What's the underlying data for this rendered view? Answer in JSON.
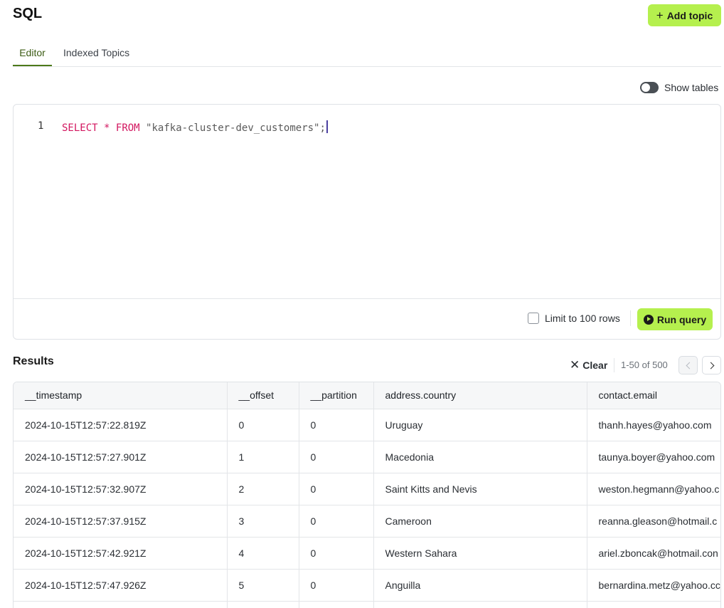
{
  "page": {
    "title": "SQL",
    "add_topic_label": "Add topic"
  },
  "tabs": [
    {
      "label": "Editor",
      "active": true
    },
    {
      "label": "Indexed Topics",
      "active": false
    }
  ],
  "show_tables": {
    "label": "Show tables",
    "enabled": false
  },
  "editor": {
    "line_number": "1",
    "tokens": {
      "select": "SELECT",
      "star": "*",
      "from": "FROM",
      "table": "\"kafka-cluster-dev_customers\"",
      "semicolon": ";"
    }
  },
  "controls": {
    "limit_label": "Limit to 100 rows",
    "limit_checked": false,
    "run_label": "Run query"
  },
  "results": {
    "title": "Results",
    "clear_label": "Clear",
    "range_label": "1-50 of 500",
    "columns": [
      "__timestamp",
      "__offset",
      "__partition",
      "address.country",
      "contact.email"
    ],
    "rows": [
      [
        "2024-10-15T12:57:22.819Z",
        "0",
        "0",
        "Uruguay",
        "thanh.hayes@yahoo.com"
      ],
      [
        "2024-10-15T12:57:27.901Z",
        "1",
        "0",
        "Macedonia",
        "taunya.boyer@yahoo.com"
      ],
      [
        "2024-10-15T12:57:32.907Z",
        "2",
        "0",
        "Saint Kitts and Nevis",
        "weston.hegmann@yahoo.c"
      ],
      [
        "2024-10-15T12:57:37.915Z",
        "3",
        "0",
        "Cameroon",
        "reanna.gleason@hotmail.c"
      ],
      [
        "2024-10-15T12:57:42.921Z",
        "4",
        "0",
        "Western Sahara",
        "ariel.zboncak@hotmail.con"
      ],
      [
        "2024-10-15T12:57:47.926Z",
        "5",
        "0",
        "Anguilla",
        "bernardina.metz@yahoo.cc"
      ],
      [
        "",
        "",
        "",
        "",
        ""
      ]
    ]
  },
  "colors": {
    "accent": "#b5f04e",
    "tab_active": "#3b5b13",
    "keyword": "#d2165f"
  }
}
